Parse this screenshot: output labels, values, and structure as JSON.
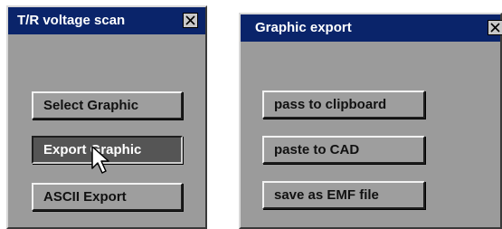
{
  "left_panel": {
    "title": "T/R voltage scan",
    "buttons": [
      {
        "label": "Select Graphic",
        "state": "normal"
      },
      {
        "label": "Export Graphic",
        "state": "pressed"
      },
      {
        "label": "ASCII Export",
        "state": "normal"
      }
    ]
  },
  "right_panel": {
    "title": "Graphic export",
    "buttons": [
      {
        "label": "pass to clipboard"
      },
      {
        "label": "paste to CAD"
      },
      {
        "label": "save as EMF file"
      }
    ]
  },
  "icons": {
    "close": "close-icon",
    "cursor": "mouse-pointer-icon"
  },
  "colors": {
    "panel_bg": "#9b9b9b",
    "titlebar_bg": "#0a246a",
    "button_pressed_bg": "#555555"
  }
}
